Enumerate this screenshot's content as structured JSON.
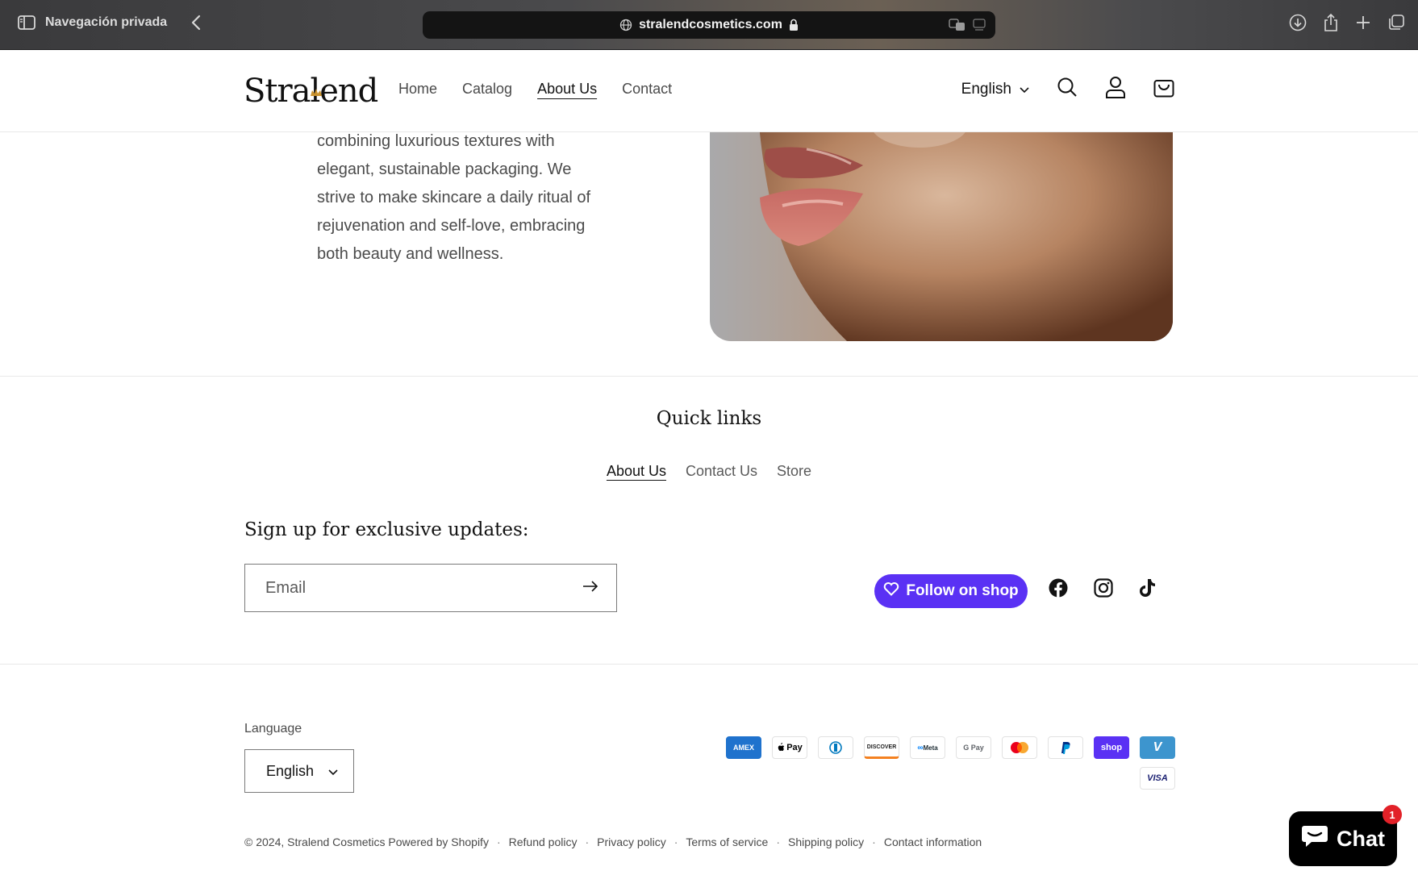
{
  "browser": {
    "sidebar_label": "Navegación privada",
    "url": "stralendcosmetics.com"
  },
  "header": {
    "logo": "Stralend",
    "nav": [
      "Home",
      "Catalog",
      "About Us",
      "Contact"
    ],
    "active_nav": "About Us",
    "language": "English"
  },
  "about": {
    "lines": [
      "combining luxurious textures with",
      "elegant, sustainable packaging. We",
      "strive to make skincare a daily ritual of",
      "rejuvenation and self-love, embracing",
      "both beauty and wellness."
    ]
  },
  "quick_links": {
    "title": "Quick links",
    "links": [
      "About Us",
      "Contact Us",
      "Store"
    ]
  },
  "newsletter": {
    "title": "Sign up for exclusive updates:",
    "email_placeholder": "Email"
  },
  "follow": {
    "label": "Follow on shop",
    "color": "#5a31f4"
  },
  "socials": [
    "facebook-icon",
    "instagram-icon",
    "tiktok-icon"
  ],
  "footer": {
    "language_label": "Language",
    "language_value": "English",
    "payments": [
      "AMEX",
      "Pay",
      "Diners",
      "DISCOVER",
      "Meta",
      "G Pay",
      "Mastercard",
      "PayPal",
      "shop",
      "V",
      "VISA"
    ],
    "copyright": "© 2024,",
    "brand_link": "Stralend Cosmetics",
    "powered": "Powered by Shopify",
    "policies": [
      "Refund policy",
      "Privacy policy",
      "Terms of service",
      "Shipping policy",
      "Contact information"
    ]
  },
  "chat": {
    "label": "Chat",
    "badge": "1"
  }
}
